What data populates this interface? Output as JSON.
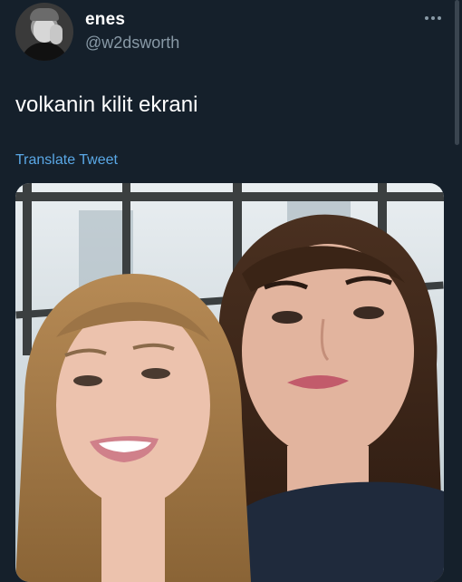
{
  "author": {
    "display_name": "enes",
    "handle": "@w2dsworth"
  },
  "tweet": {
    "text": "volkanin kilit ekrani",
    "translate_label": "Translate Tweet"
  },
  "icons": {
    "more": "more-horizontal-icon"
  },
  "colors": {
    "background": "#15202b",
    "secondary_text": "#8899a6",
    "link": "#5aa8e6"
  }
}
